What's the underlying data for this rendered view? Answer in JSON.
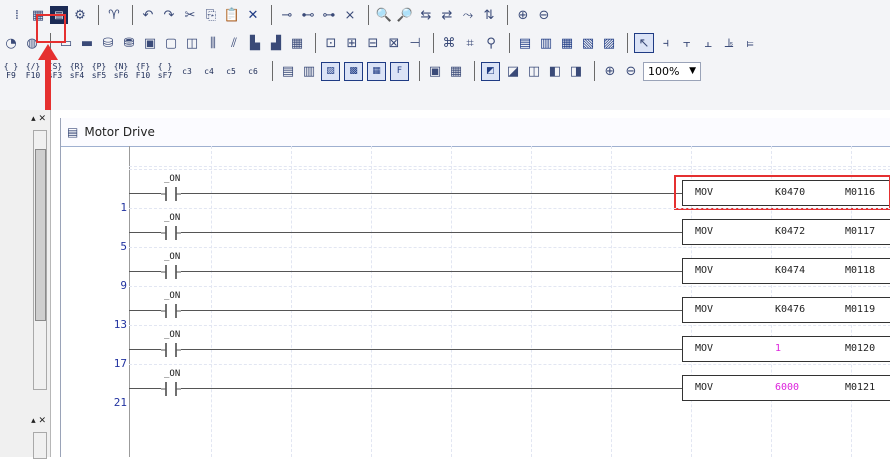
{
  "toolbar": {
    "zoom_value": "100%",
    "fkeys": [
      {
        "top": "{ }",
        "bottom": "F9"
      },
      {
        "top": "{/}",
        "bottom": "F10"
      },
      {
        "top": "{S}",
        "bottom": "sF3"
      },
      {
        "top": "{R}",
        "bottom": "sF4"
      },
      {
        "top": "{P}",
        "bottom": "sF5"
      },
      {
        "top": "{N}",
        "bottom": "sF6"
      },
      {
        "top": "{F}",
        "bottom": "F10"
      },
      {
        "top": "{ }",
        "bottom": "sF7"
      },
      {
        "top": "",
        "bottom": "c3"
      },
      {
        "top": "",
        "bottom": "c4"
      },
      {
        "top": "",
        "bottom": "c5"
      },
      {
        "top": "",
        "bottom": "c6"
      }
    ]
  },
  "editor": {
    "title": "Motor Drive"
  },
  "rungs": [
    {
      "step": "1",
      "contact": "_ON",
      "op": "MOV",
      "src": "K0470",
      "dst": "M0116",
      "src_color": "#222222",
      "selected": true
    },
    {
      "step": "5",
      "contact": "_ON",
      "op": "MOV",
      "src": "K0472",
      "dst": "M0117",
      "src_color": "#222222",
      "selected": false
    },
    {
      "step": "9",
      "contact": "_ON",
      "op": "MOV",
      "src": "K0474",
      "dst": "M0118",
      "src_color": "#222222",
      "selected": false
    },
    {
      "step": "13",
      "contact": "_ON",
      "op": "MOV",
      "src": "K0476",
      "dst": "M0119",
      "src_color": "#222222",
      "selected": false
    },
    {
      "step": "17",
      "contact": "_ON",
      "op": "MOV",
      "src": "1",
      "dst": "M0120",
      "src_color": "#dd22dd",
      "selected": false
    },
    {
      "step": "21",
      "contact": "_ON",
      "op": "MOV",
      "src": "6000",
      "dst": "M0121",
      "src_color": "#dd22dd",
      "selected": false
    }
  ],
  "colors": {
    "highlight": "#e53030",
    "step_number": "#2233a0"
  }
}
